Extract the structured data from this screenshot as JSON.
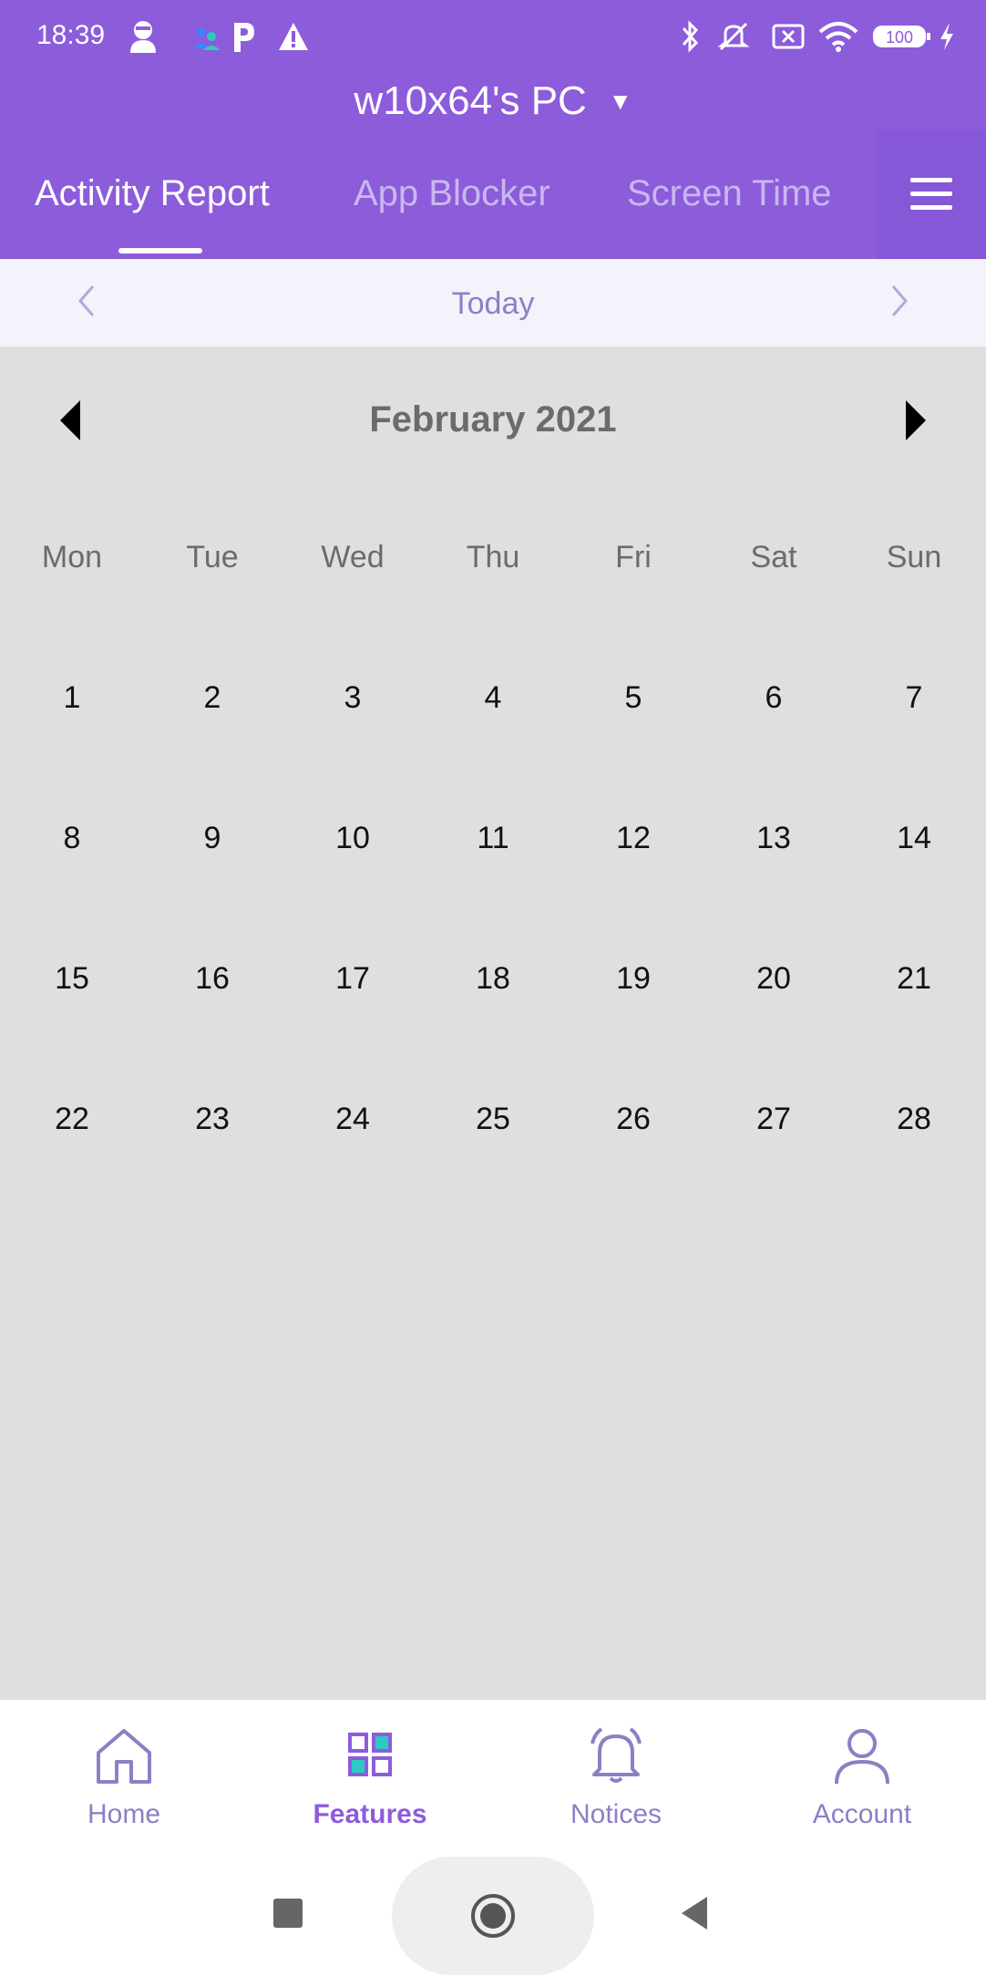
{
  "status_bar": {
    "time": "18:39",
    "battery": "100",
    "icons": [
      "avatar-icon",
      "people-icon",
      "p-icon",
      "warning-icon",
      "bluetooth-icon",
      "mute-icon",
      "sim-x-icon",
      "wifi-icon",
      "battery-icon",
      "charging-icon"
    ]
  },
  "device": {
    "name": "w10x64's PC"
  },
  "tabs": [
    {
      "label": "Activity Report",
      "active": true
    },
    {
      "label": "App Blocker",
      "active": false
    },
    {
      "label": "Screen Time",
      "active": false
    }
  ],
  "date_nav": {
    "label": "Today"
  },
  "calendar": {
    "title": "February 2021",
    "weekdays": [
      "Mon",
      "Tue",
      "Wed",
      "Thu",
      "Fri",
      "Sat",
      "Sun"
    ],
    "weeks": [
      [
        "1",
        "2",
        "3",
        "4",
        "5",
        "6",
        "7"
      ],
      [
        "8",
        "9",
        "10",
        "11",
        "12",
        "13",
        "14"
      ],
      [
        "15",
        "16",
        "17",
        "18",
        "19",
        "20",
        "21"
      ],
      [
        "22",
        "23",
        "24",
        "25",
        "26",
        "27",
        "28"
      ]
    ]
  },
  "bottom_nav": {
    "items": [
      {
        "label": "Home",
        "icon": "home-icon",
        "active": false
      },
      {
        "label": "Features",
        "icon": "features-icon",
        "active": true
      },
      {
        "label": "Notices",
        "icon": "bell-icon",
        "active": false
      },
      {
        "label": "Account",
        "icon": "account-icon",
        "active": false
      }
    ]
  },
  "colors": {
    "brand": "#8c5cdb",
    "accent_teal": "#2ec9c0",
    "muted_purple": "#8f7ec4"
  }
}
